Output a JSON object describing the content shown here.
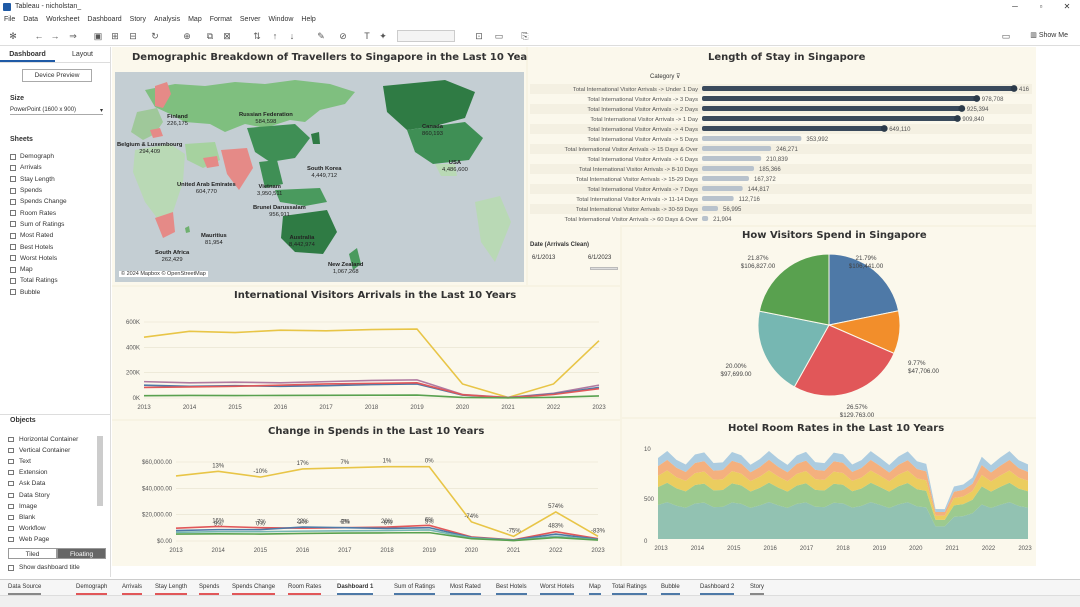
{
  "app": {
    "title": "Tableau - nicholstan_",
    "menu": [
      "File",
      "Data",
      "Worksheet",
      "Dashboard",
      "Story",
      "Analysis",
      "Map",
      "Format",
      "Server",
      "Window",
      "Help"
    ],
    "show_me": "Show Me"
  },
  "left_pane": {
    "tabs": [
      "Dashboard",
      "Layout"
    ],
    "device_preview": "Device Preview",
    "size_label": "Size",
    "size_value": "PowerPoint (1600 x 900)",
    "sheets_label": "Sheets",
    "sheets": [
      "Demograph",
      "Arrivals",
      "Stay Length",
      "Spends",
      "Spends Change",
      "Room Rates",
      "Sum of Ratings",
      "Most Rated",
      "Best Hotels",
      "Worst Hotels",
      "Map",
      "Total Ratings",
      "Bubble"
    ],
    "objects_label": "Objects",
    "objects": [
      "Horizontal Container",
      "Vertical Container",
      "Text",
      "Extension",
      "Ask Data",
      "Data Story",
      "Image",
      "Blank",
      "Workflow",
      "Web Page"
    ],
    "tiled": "Tiled",
    "floating": "Floating",
    "show_title": "Show dashboard title"
  },
  "dashboard": {
    "map": {
      "title": "Demographic Breakdown of Travellers to Singapore in the Last 10 Years",
      "labels": [
        {
          "name": "Finland",
          "value": "226,175"
        },
        {
          "name": "Russian Federation",
          "value": "584,598"
        },
        {
          "name": "Belgium & Luxembourg",
          "value": "294,409"
        },
        {
          "name": "Canada",
          "value": "860,193"
        },
        {
          "name": "USA",
          "value": "4,486,600"
        },
        {
          "name": "South Korea",
          "value": "4,449,712"
        },
        {
          "name": "United Arab Emirates",
          "value": "604,770"
        },
        {
          "name": "Vietnam",
          "value": "3,950,511"
        },
        {
          "name": "Brunei Darussalam",
          "value": "956,911"
        },
        {
          "name": "Mauritius",
          "value": "81,954"
        },
        {
          "name": "South Africa",
          "value": "262,429"
        },
        {
          "name": "Australia",
          "value": "8,442,974"
        },
        {
          "name": "New Zealand",
          "value": "1,067,268"
        }
      ],
      "copyright": "© 2024 Mapbox © OpenStreetMap"
    },
    "stay": {
      "title": "Length of Stay in Singapore",
      "column_header": "Category",
      "date_filter_label": "Date (Arrivals Clean)",
      "date_start": "6/1/2013",
      "date_end": "6/1/2023"
    },
    "spend_pie": {
      "title": "How Visitors Spend in Singapore"
    },
    "arrivals": {
      "title": "International Visitors Arrivals in the Last 10 Years"
    },
    "spend_change": {
      "title": "Change in Spends in the Last 10 Years"
    },
    "hotel": {
      "title": "Hotel Room Rates in the Last 10 Years"
    }
  },
  "tabs": [
    "Data Source",
    "Demograph",
    "Arrivals",
    "Stay Length",
    "Spends",
    "Spends Change",
    "Room Rates",
    "Dashboard 1",
    "Sum of Ratings",
    "Most Rated",
    "Best Hotels",
    "Worst Hotels",
    "Map",
    "Total Ratings",
    "Bubble",
    "Dashboard 2",
    "Story"
  ],
  "chart_data": [
    {
      "type": "bar",
      "title": "Length of Stay in Singapore",
      "categories": [
        "Total International Visitor Arrivals -> Under 1 Day",
        "Total International Visitor Arrivals -> 3 Days",
        "Total International Visitor Arrivals -> 2 Days",
        "Total International Visitor Arrivals -> 1 Day",
        "Total International Visitor Arrivals -> 4 Days",
        "Total International Visitor Arrivals -> 5 Days",
        "Total International Visitor Arrivals -> 15 Days & Over",
        "Total International Visitor Arrivals -> 6 Days",
        "Total International Visitor Arrivals -> 8-10 Days",
        "Total International Visitor Arrivals -> 15-29 Days",
        "Total International Visitor Arrivals -> 7 Days",
        "Total International Visitor Arrivals -> 11-14 Days",
        "Total International Visitor Arrivals -> 30-59 Days",
        "Total International Visitor Arrivals -> 60 Days & Over"
      ],
      "values": [
        1111416,
        978708,
        925394,
        909840,
        649110,
        353992,
        246271,
        210839,
        185366,
        167372,
        144817,
        112716,
        56995,
        21904
      ],
      "value_labels": [
        "416",
        "978,708",
        "925,394",
        "909,840",
        "649,110",
        "353,992",
        "246,271",
        "210,839",
        "185,366",
        "167,372",
        "144,817",
        "112,716",
        "56,995",
        "21,904"
      ]
    },
    {
      "type": "pie",
      "title": "How Visitors Spend in Singapore",
      "slices": [
        {
          "value": 106441,
          "percent": "21.79%",
          "value_label": "$106,441.00",
          "color": "#4e79a7"
        },
        {
          "value": 47706,
          "percent": "9.77%",
          "value_label": "$47,706.00",
          "color": "#f28e2b"
        },
        {
          "value": 129763,
          "percent": "26.57%",
          "value_label": "$129,763.00",
          "color": "#e15759"
        },
        {
          "value": 97699,
          "percent": "20.00%",
          "value_label": "$97,699.00",
          "color": "#76b7b2"
        },
        {
          "value": 106827,
          "percent": "21.87%",
          "value_label": "$106,827.00",
          "color": "#59a14f"
        }
      ]
    },
    {
      "type": "line",
      "title": "International Visitors Arrivals in the Last 10 Years",
      "x": [
        2013,
        2014,
        2015,
        2016,
        2017,
        2018,
        2019,
        2020,
        2021,
        2022,
        2023
      ],
      "x_ticks": [
        "2013",
        "2014",
        "2015",
        "2016",
        "2017",
        "2018",
        "2019",
        "2020",
        "2021",
        "2022",
        "2023"
      ],
      "y_ticks": [
        "600K",
        "400K",
        "200K",
        "0K"
      ],
      "ylim": [
        0,
        650000
      ],
      "series": [
        {
          "color": "#e8c547",
          "values": [
            520000,
            570000,
            560000,
            580000,
            575000,
            585000,
            590000,
            120000,
            5000,
            120000,
            490000
          ]
        },
        {
          "color": "#b07aa1",
          "values": [
            140000,
            130000,
            135000,
            130000,
            140000,
            150000,
            155000,
            30000,
            5000,
            40000,
            110000
          ]
        },
        {
          "color": "#4e79a7",
          "values": [
            110000,
            100000,
            105000,
            100000,
            105000,
            115000,
            120000,
            25000,
            3000,
            35000,
            90000
          ]
        },
        {
          "color": "#e15759",
          "values": [
            90000,
            95000,
            100000,
            110000,
            120000,
            125000,
            130000,
            28000,
            2000,
            30000,
            80000
          ]
        },
        {
          "color": "#59a14f",
          "values": [
            20000,
            22000,
            21000,
            22000,
            23000,
            24000,
            25000,
            5000,
            1000,
            6000,
            18000
          ]
        }
      ]
    },
    {
      "type": "line",
      "title": "Change in Spends in the Last 10 Years",
      "x_ticks": [
        "2013",
        "2014",
        "2015",
        "2016",
        "2017",
        "2018",
        "2019",
        "2020",
        "2021",
        "2022",
        "2023"
      ],
      "y_ticks": [
        "$60,000.00",
        "$40,000.00",
        "$20,000.00",
        "$0.00"
      ],
      "ylim": [
        0,
        68000
      ],
      "series": [
        {
          "color": "#e8c547",
          "values": [
            56000,
            60000,
            55000,
            62000,
            63000,
            64000,
            64000,
            16500,
            4000,
            25000,
            4000
          ],
          "labels": [
            "",
            "13%",
            "-10%",
            "17%",
            "7%",
            "1%",
            "0%",
            "-74%",
            "-75%",
            "574%",
            "-83%"
          ]
        },
        {
          "color": "#e15759",
          "values": [
            11000,
            12500,
            11500,
            11000,
            11500,
            12000,
            13500,
            3500,
            1000,
            8000,
            2000
          ],
          "labels": [
            "",
            "16%",
            "-7%",
            "2%",
            "8%",
            "20%",
            "6%",
            "",
            "",
            "483%",
            ""
          ]
        },
        {
          "color": "#4e79a7",
          "values": [
            9000,
            9800,
            9800,
            12000,
            11500,
            10800,
            11500,
            3000,
            800,
            6000,
            1500
          ],
          "labels": [
            "",
            "9%",
            "0%",
            "22%",
            "-2%",
            "-6%",
            "5%",
            "",
            "",
            "",
            ""
          ]
        },
        {
          "color": "#76b7b2",
          "values": [
            7500,
            8000,
            8000,
            8500,
            8800,
            9000,
            9500,
            2500,
            500,
            4000,
            1000
          ]
        },
        {
          "color": "#59a14f",
          "values": [
            6000,
            6200,
            6000,
            6500,
            6800,
            7000,
            7200,
            2000,
            400,
            3000,
            800
          ]
        }
      ]
    },
    {
      "type": "area",
      "title": "Hotel Room Rates in the Last 10 Years",
      "x_ticks": [
        "2013",
        "2014",
        "2015",
        "2016",
        "2017",
        "2018",
        "2019",
        "2020",
        "2021",
        "2022",
        "2023"
      ],
      "y_ticks": [
        "10",
        "500",
        "0"
      ],
      "series": [
        {
          "color": "#7fb8a8"
        },
        {
          "color": "#8bc27f"
        },
        {
          "color": "#e8c547"
        },
        {
          "color": "#f2a36b"
        },
        {
          "color": "#9ec4de"
        }
      ]
    }
  ]
}
